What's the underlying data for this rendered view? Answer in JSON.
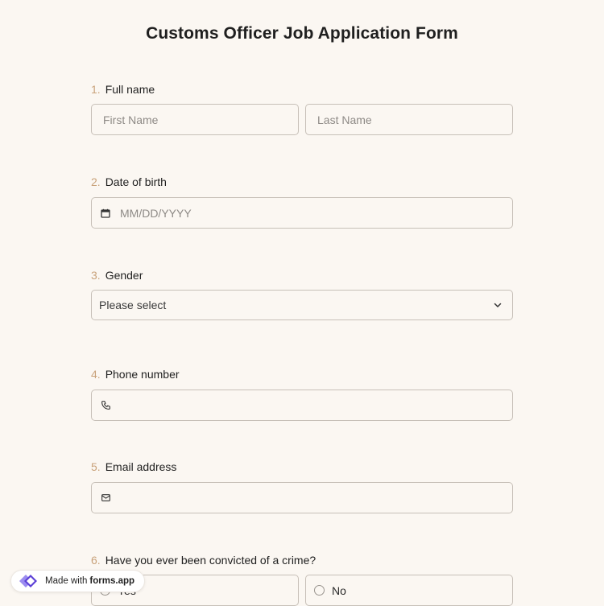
{
  "form": {
    "title": "Customs Officer Job Application Form"
  },
  "questions": [
    {
      "number": "1.",
      "label": "Full name",
      "fields": [
        {
          "placeholder": "First Name"
        },
        {
          "placeholder": "Last Name"
        }
      ]
    },
    {
      "number": "2.",
      "label": "Date of birth",
      "placeholder": "MM/DD/YYYY",
      "icon": "calendar-icon"
    },
    {
      "number": "3.",
      "label": "Gender",
      "selected": "Please select",
      "icon": "chevron-down-icon"
    },
    {
      "number": "4.",
      "label": "Phone number",
      "icon": "phone-icon"
    },
    {
      "number": "5.",
      "label": "Email address",
      "icon": "mail-icon"
    },
    {
      "number": "6.",
      "label": "Have you ever been convicted of a crime?",
      "options": [
        "Yes",
        "No"
      ]
    }
  ],
  "badge": {
    "prefix": "Made with",
    "brand": "forms.app"
  },
  "colors": {
    "background": "#fbf7f2",
    "number_accent": "#c9a27a",
    "border": "#c7c0b8"
  }
}
